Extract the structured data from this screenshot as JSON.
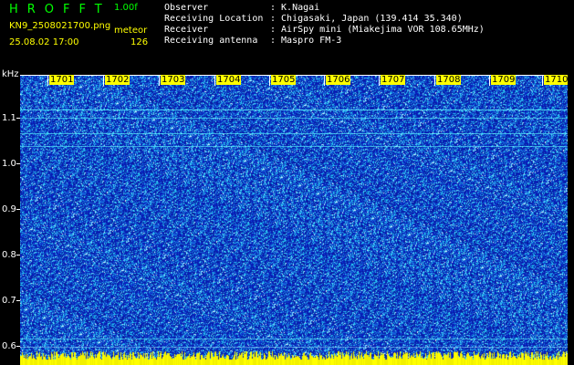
{
  "header": {
    "app_title": "HROFFT",
    "version": "1.00f",
    "file_name": "KN9_2508021700.png",
    "meteor_label": "meteor",
    "datetime": "25.08.02 17:00",
    "count": "126"
  },
  "station": {
    "observer_label": "Observer",
    "observer_value": ": K.Nagai",
    "location_label": "Receiving Location",
    "location_value": ": Chigasaki, Japan (139.414 35.340)",
    "receiver_label": "Receiver",
    "receiver_value": ": AirSpy mini (Miakejima VOR 108.65MHz)",
    "antenna_label": "Receiving antenna",
    "antenna_value": ": Maspro FM-3"
  },
  "axis": {
    "y_unit": "kHz",
    "y_ticks": [
      "1.1",
      "1.0",
      "0.9",
      "0.8",
      "0.7",
      "0.6"
    ],
    "x_ticks": [
      "1701",
      "1702",
      "1703",
      "1704",
      "1705",
      "1706",
      "1707",
      "1708",
      "1709",
      "1710"
    ]
  },
  "colors": {
    "background": "#000000",
    "spectrum_base": "#0a1fb4",
    "noise_cyan": "#00e5ff",
    "noise_light": "#7fd0ff",
    "line_cyan": "#3cf0ff",
    "accent_green": "#00ff00",
    "accent_yellow": "#ffff00"
  }
}
